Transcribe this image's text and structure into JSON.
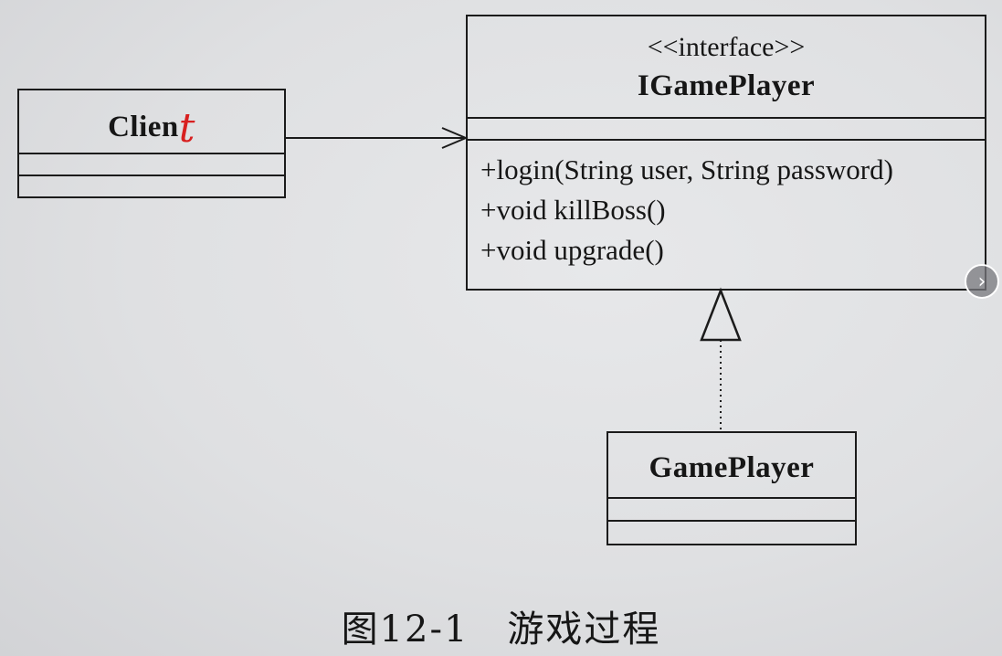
{
  "client": {
    "name": "Clien",
    "handwritten_suffix": "t"
  },
  "interface": {
    "stereotype": "<<interface>>",
    "name": "IGamePlayer",
    "methods": [
      "+login(String user, String password)",
      "+void killBoss()",
      "+void upgrade()"
    ]
  },
  "implementation": {
    "name": "GamePlayer"
  },
  "caption": "图12-1　游戏过程",
  "icons": {
    "next_page": "chevron-right-icon"
  },
  "colors": {
    "ink": "#1b1b1b",
    "handwriting": "#d82020",
    "paper": "#e2e3e5"
  }
}
